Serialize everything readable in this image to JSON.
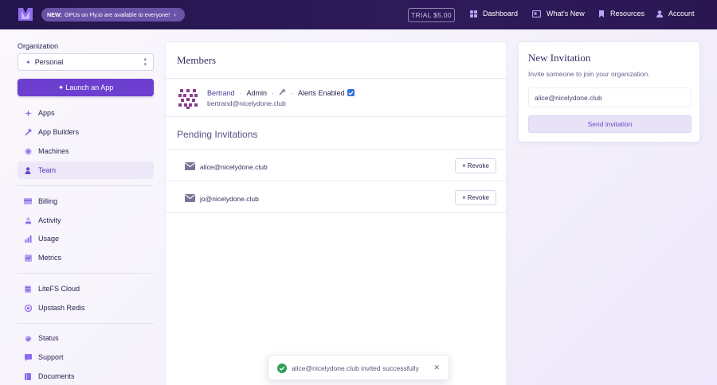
{
  "topbar": {
    "announce_badge": "NEW:",
    "announce_text": "GPUs on Fly.io are available to everyone!",
    "trial": "TRIAL $5.00",
    "nav": [
      "Dashboard",
      "What's New",
      "Resources",
      "Account"
    ]
  },
  "sidebar": {
    "org_label": "Organization",
    "org_value": "Personal",
    "launch_label": "Launch an App",
    "groups": [
      [
        "Apps",
        "App Builders",
        "Machines",
        "Team"
      ],
      [
        "Billing",
        "Activity",
        "Usage",
        "Metrics"
      ],
      [
        "LiteFS Cloud",
        "Upstash Redis"
      ],
      [
        "Status",
        "Support",
        "Documents"
      ]
    ],
    "active_item": "Team"
  },
  "members": {
    "title": "Members",
    "name": "Bertrand",
    "role": "Admin",
    "alerts": "Alerts Enabled",
    "email": "bertrand@nicelydone.club"
  },
  "pending": {
    "title": "Pending Invitations",
    "revoke_label": "Revoke",
    "invites": [
      "alice@nicelydone.club",
      "jo@nicelydone.club"
    ]
  },
  "new_invitation": {
    "title": "New Invitation",
    "description": "Invite someone to join your organization.",
    "input_value": "alice@nicelydone.club",
    "send_label": "Send invitation"
  },
  "toast": {
    "message": "alice@nicelydone.club invited successfully"
  },
  "colors": {
    "accent": "#6c3fd0",
    "nav_bg": "#2a1752",
    "active_bg": "#ece8f8",
    "success": "#2e9e5b",
    "checkbox": "#2f6fe0"
  }
}
